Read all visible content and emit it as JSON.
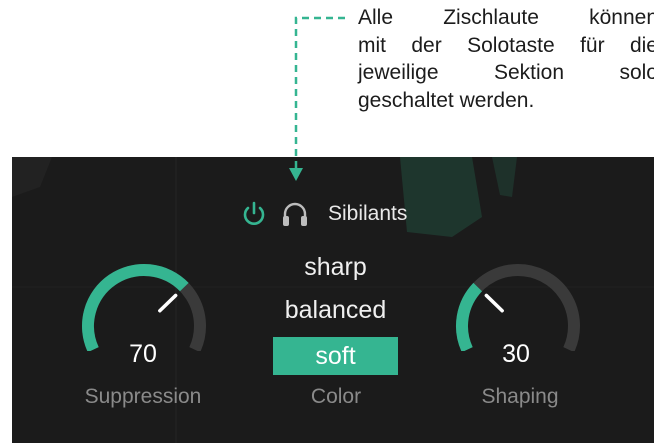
{
  "callout": {
    "line1": "Alle Zischlaute können",
    "line2": "mit der Solotaste für die",
    "line3": "jeweilige Sektion solo",
    "line4": "geschaltet werden."
  },
  "section": {
    "title": "Sibilants",
    "power_icon": "power-icon",
    "solo_icon": "headphones-icon"
  },
  "suppression": {
    "value": "70",
    "label": "Suppression",
    "level": 0.7
  },
  "shaping": {
    "value": "30",
    "label": "Shaping",
    "level": 0.3
  },
  "color": {
    "label": "Color",
    "options": [
      "sharp",
      "balanced",
      "soft"
    ],
    "selected": "soft"
  },
  "colors": {
    "accent": "#35b591",
    "panel": "#1b1b1b",
    "track": "#3a3a3a"
  }
}
